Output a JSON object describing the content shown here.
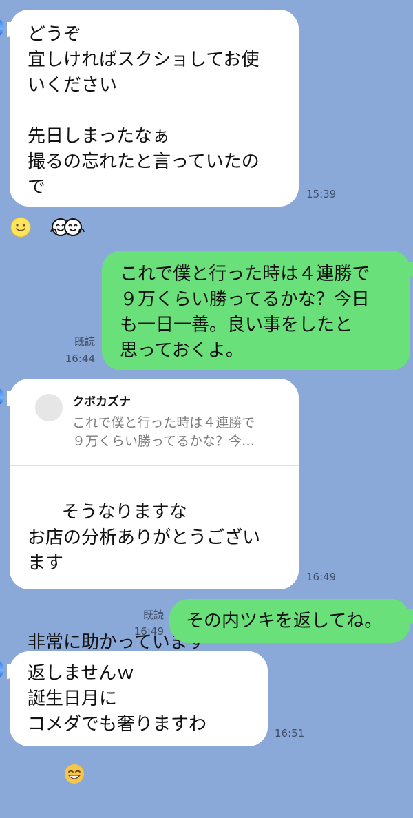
{
  "messages": [
    {
      "side": "incoming",
      "text": "どうぞ\n宜しければスクショしてお使\nいください\n\n先日しまったなぁ\n撮るの忘れたと言っていたの\nで",
      "time": "15:39",
      "reaction": "smile-reaction"
    },
    {
      "side": "outgoing",
      "text": "これで僕と行った時は４連勝で\n９万くらい勝ってるかな？今日\nも一日一善。良い事をしたと\n思っておくよ。",
      "read": "既読",
      "time": "16:44"
    },
    {
      "side": "incoming",
      "reply": {
        "name": "クボカズナ",
        "text": "これで僕と行った時は４連勝で\n９万くらい勝ってるかな？今…"
      },
      "text": "そうなりますな\nお店の分析ありがとうござい\nます\n非常に助かっています",
      "emoji": "bowing-person-emoji",
      "time": "16:49"
    },
    {
      "side": "outgoing",
      "text": "その内ツキを返してね。",
      "read": "既読",
      "time": "16:49"
    },
    {
      "side": "incoming",
      "text": "返しませんｗ\n誕生日月に\nコメダでも奢りますわ",
      "emoji": "grinning-face-emoji",
      "time": "16:51"
    }
  ],
  "colors": {
    "background": "#8aa8d8",
    "incoming_bubble": "#ffffff",
    "outgoing_bubble": "#6ae07a",
    "meta_text": "#3f4e64"
  }
}
